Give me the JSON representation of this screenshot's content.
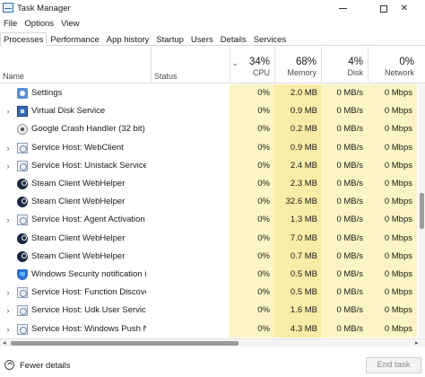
{
  "window": {
    "title": "Task Manager",
    "buttons": {
      "minimize": "minimize-icon",
      "maximize": "maximize-icon",
      "close": "✕"
    }
  },
  "menu": [
    "File",
    "Options",
    "View"
  ],
  "tabs": [
    "Processes",
    "Performance",
    "App history",
    "Startup",
    "Users",
    "Details",
    "Services"
  ],
  "active_tab": "Processes",
  "columns": {
    "name": "Name",
    "status": "Status",
    "cpu": {
      "percent": "34%",
      "label": "CPU"
    },
    "memory": {
      "percent": "68%",
      "label": "Memory"
    },
    "disk": {
      "percent": "4%",
      "label": "Disk"
    },
    "network": {
      "percent": "0%",
      "label": "Network"
    }
  },
  "colors": {
    "heat_light": "#fbf4c4",
    "heat_mem": "#f8eda7"
  },
  "processes": [
    {
      "expander": "",
      "icon": "settings-gear-icon",
      "name": "Settings",
      "cpu": "0%",
      "memory": "2.0 MB",
      "disk": "0 MB/s",
      "network": "0 Mbps"
    },
    {
      "expander": "›",
      "icon": "virtual-disk-icon",
      "name": "Virtual Disk Service",
      "cpu": "0%",
      "memory": "0.9 MB",
      "disk": "0 MB/s",
      "network": "0 Mbps"
    },
    {
      "expander": "",
      "icon": "crash-handler-icon",
      "name": "Google Crash Handler (32 bit)",
      "cpu": "0%",
      "memory": "0.2 MB",
      "disk": "0 MB/s",
      "network": "0 Mbps"
    },
    {
      "expander": "›",
      "icon": "service-host-icon",
      "name": "Service Host: WebClient",
      "cpu": "0%",
      "memory": "0.9 MB",
      "disk": "0 MB/s",
      "network": "0 Mbps"
    },
    {
      "expander": "›",
      "icon": "service-host-icon",
      "name": "Service Host: Unistack Service G...",
      "cpu": "0%",
      "memory": "2.4 MB",
      "disk": "0 MB/s",
      "network": "0 Mbps"
    },
    {
      "expander": "",
      "icon": "steam-icon",
      "name": "Steam Client WebHelper",
      "cpu": "0%",
      "memory": "2.3 MB",
      "disk": "0 MB/s",
      "network": "0 Mbps"
    },
    {
      "expander": "",
      "icon": "steam-icon",
      "name": "Steam Client WebHelper",
      "cpu": "0%",
      "memory": "32.6 MB",
      "disk": "0 MB/s",
      "network": "0 Mbps"
    },
    {
      "expander": "›",
      "icon": "service-host-icon",
      "name": "Service Host: Agent Activation R...",
      "cpu": "0%",
      "memory": "1.3 MB",
      "disk": "0 MB/s",
      "network": "0 Mbps"
    },
    {
      "expander": "",
      "icon": "steam-icon",
      "name": "Steam Client WebHelper",
      "cpu": "0%",
      "memory": "7.0 MB",
      "disk": "0 MB/s",
      "network": "0 Mbps"
    },
    {
      "expander": "",
      "icon": "steam-icon",
      "name": "Steam Client WebHelper",
      "cpu": "0%",
      "memory": "0.7 MB",
      "disk": "0 MB/s",
      "network": "0 Mbps"
    },
    {
      "expander": "",
      "icon": "windows-security-shield-icon",
      "name": "Windows Security notification ic...",
      "cpu": "0%",
      "memory": "0.5 MB",
      "disk": "0 MB/s",
      "network": "0 Mbps"
    },
    {
      "expander": "›",
      "icon": "service-host-icon",
      "name": "Service Host: Function Discover...",
      "cpu": "0%",
      "memory": "0.5 MB",
      "disk": "0 MB/s",
      "network": "0 Mbps"
    },
    {
      "expander": "›",
      "icon": "service-host-icon",
      "name": "Service Host: Udk User Service_...",
      "cpu": "0%",
      "memory": "1.6 MB",
      "disk": "0 MB/s",
      "network": "0 Mbps"
    },
    {
      "expander": "›",
      "icon": "service-host-icon",
      "name": "Service Host: Windows Push No...",
      "cpu": "0%",
      "memory": "4.3 MB",
      "disk": "0 MB/s",
      "network": "0 Mbps"
    }
  ],
  "footer": {
    "fewer_details": "Fewer details",
    "end_task": "End task"
  }
}
